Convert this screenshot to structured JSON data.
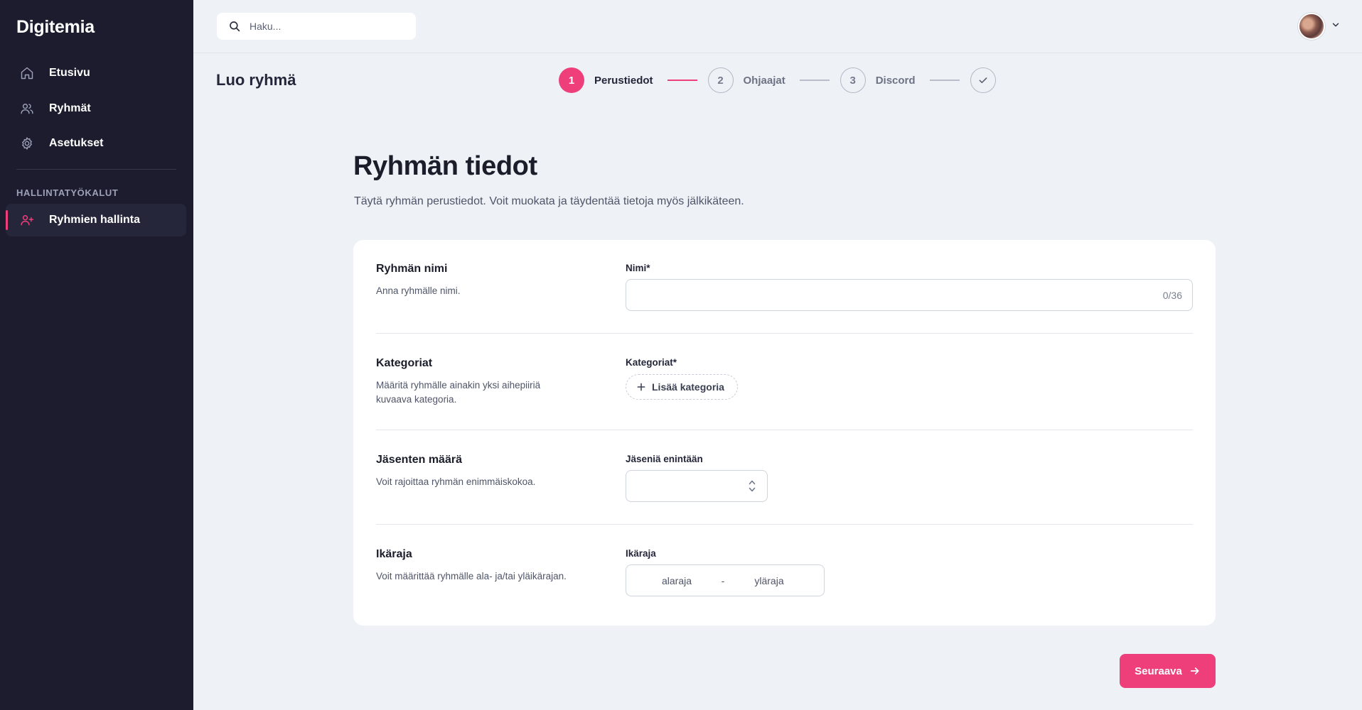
{
  "app": {
    "brand": "Digitemia"
  },
  "sidebar": {
    "items": [
      {
        "label": "Etusivu",
        "icon": "home-icon"
      },
      {
        "label": "Ryhmät",
        "icon": "users-icon"
      },
      {
        "label": "Asetukset",
        "icon": "gear-icon"
      }
    ],
    "section_title": "HALLINTATYÖKALUT",
    "admin_items": [
      {
        "label": "Ryhmien hallinta",
        "icon": "user-plus-icon",
        "active": true
      }
    ]
  },
  "search": {
    "placeholder": "Haku..."
  },
  "page": {
    "title": "Luo ryhmä"
  },
  "stepper": {
    "steps": [
      {
        "number": "1",
        "label": "Perustiedot",
        "state": "active"
      },
      {
        "number": "2",
        "label": "Ohjaajat",
        "state": "todo"
      },
      {
        "number": "3",
        "label": "Discord",
        "state": "todo"
      },
      {
        "number": "",
        "label": "",
        "state": "todo",
        "icon": "check-icon"
      }
    ]
  },
  "form": {
    "heading": "Ryhmän tiedot",
    "subheading": "Täytä ryhmän perustiedot. Voit muokata ja täydentää tietoja myös jälkikäteen.",
    "name": {
      "title": "Ryhmän nimi",
      "description": "Anna ryhmälle nimi.",
      "label": "Nimi*",
      "value": "",
      "counter": "0/36"
    },
    "categories": {
      "title": "Kategoriat",
      "description": "Määritä ryhmälle ainakin yksi aihepiiriä kuvaava kategoria.",
      "label": "Kategoriat*",
      "add_label": "Lisää kategoria"
    },
    "members": {
      "title": "Jäsenten määrä",
      "description": "Voit rajoittaa ryhmän enimmäiskokoa.",
      "label": "Jäseniä enintään",
      "value": ""
    },
    "age": {
      "title": "Ikäraja",
      "description": "Voit määrittää ryhmälle ala- ja/tai yläikärajan.",
      "label": "Ikäraja",
      "min_placeholder": "alaraja",
      "separator": "-",
      "max_placeholder": "yläraja"
    }
  },
  "actions": {
    "next_label": "Seuraava"
  },
  "colors": {
    "accent": "#ee3f7a",
    "sidebar_bg": "#1c1c2e",
    "page_bg": "#eef1f5"
  }
}
